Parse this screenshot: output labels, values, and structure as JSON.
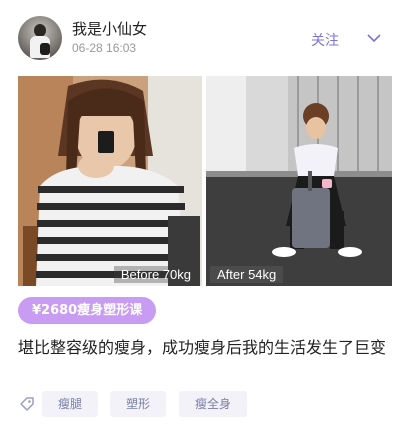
{
  "post": {
    "username": "我是小仙女",
    "datetime": "06-28 16:03",
    "follow_label": "关注",
    "accent_color": "#7d73d8",
    "photos": {
      "before_label": "Before 70kg",
      "after_label": "After 54kg"
    },
    "course_tag": "¥2680瘦身塑形课",
    "title": "堪比整容级的瘦身，成功瘦身后我的生活发生了巨变",
    "tags": [
      "瘦腿",
      "塑形",
      "瘦全身"
    ],
    "tag_icon": "tag-icon",
    "more_icon": "chevron-down-icon"
  }
}
